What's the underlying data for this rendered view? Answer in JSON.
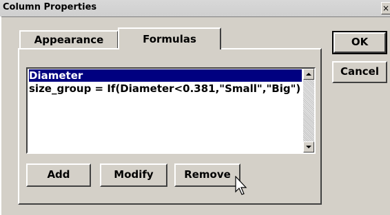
{
  "window": {
    "title": "Column Properties",
    "close_label": "×"
  },
  "tabs": [
    {
      "label": "Appearance",
      "selected": false
    },
    {
      "label": "Formulas",
      "selected": true
    }
  ],
  "formula_list": {
    "items": [
      {
        "text": "Diameter",
        "selected": true
      },
      {
        "text": "size_group = If(Diameter<0.381,\"Small\",\"Big\")",
        "selected": false
      }
    ]
  },
  "buttons": {
    "ok": "OK",
    "cancel": "Cancel",
    "add": "Add",
    "modify": "Modify",
    "remove": "Remove"
  },
  "scrollbar": {
    "up_icon": "arrow-up-icon",
    "down_icon": "arrow-down-icon"
  },
  "cursor": {
    "icon": "mouse-pointer-icon"
  },
  "colors": {
    "face": "#d4d0c8",
    "selection": "#000080",
    "highlight": "#ffffff",
    "shadow": "#404040"
  }
}
